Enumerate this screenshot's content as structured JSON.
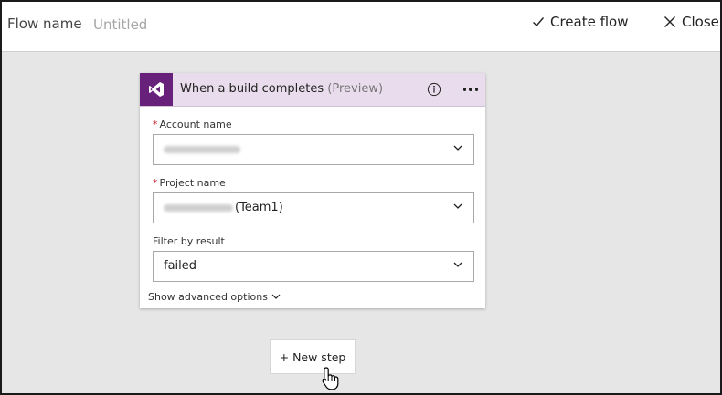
{
  "header": {
    "flow_name_label": "Flow name",
    "flow_name_placeholder": "Untitled",
    "create_flow_label": "Create flow",
    "close_label": "Close"
  },
  "trigger_card": {
    "title": "When a build completes",
    "title_suffix": "(Preview)",
    "accent_color": "#68217a",
    "header_color": "#e9dcec",
    "icon": "visual-studio-logo-icon",
    "fields": {
      "account_name": {
        "label": "Account name",
        "required": true,
        "value": ""
      },
      "project_name": {
        "label": "Project name",
        "required": true,
        "value_visible": "(Team1)"
      },
      "filter_by_result": {
        "label": "Filter by result",
        "required": false,
        "value": "failed"
      }
    },
    "advanced_options_label": "Show advanced options"
  },
  "new_step": {
    "label": "+ New step"
  },
  "icons": {
    "create": "checkmark-icon",
    "close": "close-icon",
    "info": "info-icon",
    "more": "more-options-icon",
    "chevron": "chevron-down-icon",
    "cursor": "hand-pointer-cursor-icon"
  }
}
